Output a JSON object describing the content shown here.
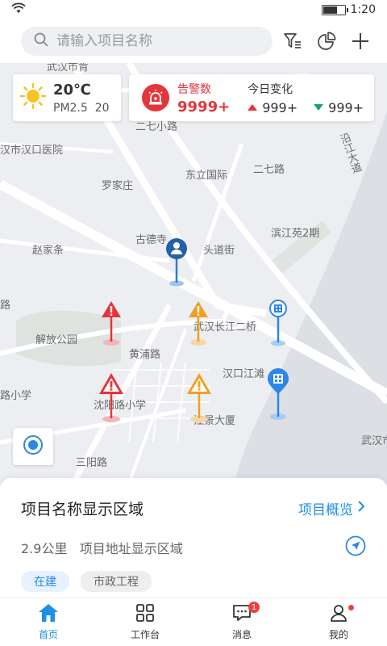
{
  "status": {
    "time": "1:20",
    "battery_level": 0.7
  },
  "search": {
    "placeholder": "请输入项目名称"
  },
  "topbar": {
    "icons": [
      "filter-icon",
      "pie-chart-icon",
      "add-icon"
    ]
  },
  "weather": {
    "temperature": "20℃",
    "pm_label": "PM2.5",
    "pm_value": "20",
    "icon": "sun-icon"
  },
  "alarm": {
    "label": "告警数",
    "count": "9999+",
    "change_title": "今日变化",
    "up_value": "999+",
    "down_value": "999+",
    "colors": {
      "alarm": "#e5343a",
      "up": "#e5343a",
      "down": "#1aa36b"
    }
  },
  "map": {
    "labels": [
      "武汉市肯",
      "二七小路",
      "汉市汉口医院",
      "东立国际",
      "二七路",
      "罗家庄",
      "沿江大道",
      "古德寺",
      "头道街",
      "滨江苑2期",
      "赵家条",
      "路",
      "武汉长江二桥",
      "解放公园",
      "黄浦路",
      "汉口江滩",
      "路小学",
      "沈阳路小学",
      "江景大厦",
      "武汉市",
      "三阳路"
    ],
    "markers": [
      "person-marker",
      "red-alert-marker",
      "orange-alert-marker",
      "building-marker",
      "red-alert-marker",
      "orange-alert-marker",
      "building-marker"
    ]
  },
  "project": {
    "name": "项目名称显示区域",
    "overview_link": "项目概览",
    "distance": "2.9公里",
    "address": "项目地址显示区域",
    "tags": [
      "在建",
      "市政工程"
    ]
  },
  "tabs": [
    {
      "label": "首页",
      "icon": "home-icon",
      "active": true
    },
    {
      "label": "工作台",
      "icon": "grid-icon"
    },
    {
      "label": "消息",
      "icon": "message-icon",
      "badge": "1"
    },
    {
      "label": "我的",
      "icon": "user-icon"
    }
  ]
}
